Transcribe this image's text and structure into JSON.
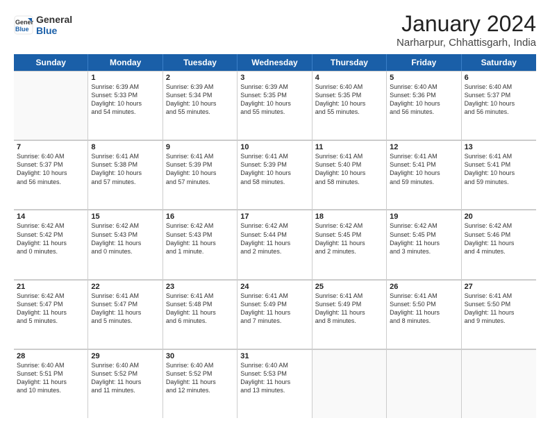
{
  "header": {
    "logo_line1": "General",
    "logo_line2": "Blue",
    "month_title": "January 2024",
    "location": "Narharpur, Chhattisgarh, India"
  },
  "weekdays": [
    "Sunday",
    "Monday",
    "Tuesday",
    "Wednesday",
    "Thursday",
    "Friday",
    "Saturday"
  ],
  "weeks": [
    [
      {
        "day": "",
        "info": ""
      },
      {
        "day": "1",
        "info": "Sunrise: 6:39 AM\nSunset: 5:33 PM\nDaylight: 10 hours\nand 54 minutes."
      },
      {
        "day": "2",
        "info": "Sunrise: 6:39 AM\nSunset: 5:34 PM\nDaylight: 10 hours\nand 55 minutes."
      },
      {
        "day": "3",
        "info": "Sunrise: 6:39 AM\nSunset: 5:35 PM\nDaylight: 10 hours\nand 55 minutes."
      },
      {
        "day": "4",
        "info": "Sunrise: 6:40 AM\nSunset: 5:35 PM\nDaylight: 10 hours\nand 55 minutes."
      },
      {
        "day": "5",
        "info": "Sunrise: 6:40 AM\nSunset: 5:36 PM\nDaylight: 10 hours\nand 56 minutes."
      },
      {
        "day": "6",
        "info": "Sunrise: 6:40 AM\nSunset: 5:37 PM\nDaylight: 10 hours\nand 56 minutes."
      }
    ],
    [
      {
        "day": "7",
        "info": "Sunrise: 6:40 AM\nSunset: 5:37 PM\nDaylight: 10 hours\nand 56 minutes."
      },
      {
        "day": "8",
        "info": "Sunrise: 6:41 AM\nSunset: 5:38 PM\nDaylight: 10 hours\nand 57 minutes."
      },
      {
        "day": "9",
        "info": "Sunrise: 6:41 AM\nSunset: 5:39 PM\nDaylight: 10 hours\nand 57 minutes."
      },
      {
        "day": "10",
        "info": "Sunrise: 6:41 AM\nSunset: 5:39 PM\nDaylight: 10 hours\nand 58 minutes."
      },
      {
        "day": "11",
        "info": "Sunrise: 6:41 AM\nSunset: 5:40 PM\nDaylight: 10 hours\nand 58 minutes."
      },
      {
        "day": "12",
        "info": "Sunrise: 6:41 AM\nSunset: 5:41 PM\nDaylight: 10 hours\nand 59 minutes."
      },
      {
        "day": "13",
        "info": "Sunrise: 6:41 AM\nSunset: 5:41 PM\nDaylight: 10 hours\nand 59 minutes."
      }
    ],
    [
      {
        "day": "14",
        "info": "Sunrise: 6:42 AM\nSunset: 5:42 PM\nDaylight: 11 hours\nand 0 minutes."
      },
      {
        "day": "15",
        "info": "Sunrise: 6:42 AM\nSunset: 5:43 PM\nDaylight: 11 hours\nand 0 minutes."
      },
      {
        "day": "16",
        "info": "Sunrise: 6:42 AM\nSunset: 5:43 PM\nDaylight: 11 hours\nand 1 minute."
      },
      {
        "day": "17",
        "info": "Sunrise: 6:42 AM\nSunset: 5:44 PM\nDaylight: 11 hours\nand 2 minutes."
      },
      {
        "day": "18",
        "info": "Sunrise: 6:42 AM\nSunset: 5:45 PM\nDaylight: 11 hours\nand 2 minutes."
      },
      {
        "day": "19",
        "info": "Sunrise: 6:42 AM\nSunset: 5:45 PM\nDaylight: 11 hours\nand 3 minutes."
      },
      {
        "day": "20",
        "info": "Sunrise: 6:42 AM\nSunset: 5:46 PM\nDaylight: 11 hours\nand 4 minutes."
      }
    ],
    [
      {
        "day": "21",
        "info": "Sunrise: 6:42 AM\nSunset: 5:47 PM\nDaylight: 11 hours\nand 5 minutes."
      },
      {
        "day": "22",
        "info": "Sunrise: 6:41 AM\nSunset: 5:47 PM\nDaylight: 11 hours\nand 5 minutes."
      },
      {
        "day": "23",
        "info": "Sunrise: 6:41 AM\nSunset: 5:48 PM\nDaylight: 11 hours\nand 6 minutes."
      },
      {
        "day": "24",
        "info": "Sunrise: 6:41 AM\nSunset: 5:49 PM\nDaylight: 11 hours\nand 7 minutes."
      },
      {
        "day": "25",
        "info": "Sunrise: 6:41 AM\nSunset: 5:49 PM\nDaylight: 11 hours\nand 8 minutes."
      },
      {
        "day": "26",
        "info": "Sunrise: 6:41 AM\nSunset: 5:50 PM\nDaylight: 11 hours\nand 8 minutes."
      },
      {
        "day": "27",
        "info": "Sunrise: 6:41 AM\nSunset: 5:50 PM\nDaylight: 11 hours\nand 9 minutes."
      }
    ],
    [
      {
        "day": "28",
        "info": "Sunrise: 6:40 AM\nSunset: 5:51 PM\nDaylight: 11 hours\nand 10 minutes."
      },
      {
        "day": "29",
        "info": "Sunrise: 6:40 AM\nSunset: 5:52 PM\nDaylight: 11 hours\nand 11 minutes."
      },
      {
        "day": "30",
        "info": "Sunrise: 6:40 AM\nSunset: 5:52 PM\nDaylight: 11 hours\nand 12 minutes."
      },
      {
        "day": "31",
        "info": "Sunrise: 6:40 AM\nSunset: 5:53 PM\nDaylight: 11 hours\nand 13 minutes."
      },
      {
        "day": "",
        "info": ""
      },
      {
        "day": "",
        "info": ""
      },
      {
        "day": "",
        "info": ""
      }
    ]
  ]
}
